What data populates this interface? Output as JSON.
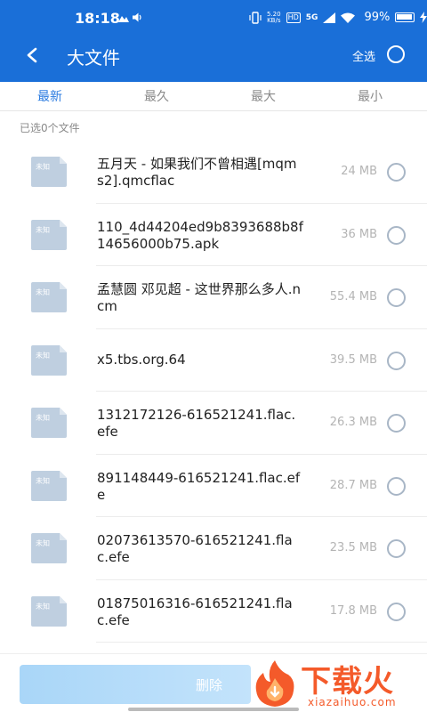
{
  "status_bar": {
    "time": "18:18",
    "speed_top": "5.20",
    "speed_unit": "KB/s",
    "hd_badge": "HD",
    "network": "5G",
    "battery": "99%"
  },
  "toolbar": {
    "title": "大文件",
    "select_all": "全选"
  },
  "tabs": [
    {
      "label": "最新",
      "active": true
    },
    {
      "label": "最久",
      "active": false
    },
    {
      "label": "最大",
      "active": false
    },
    {
      "label": "最小",
      "active": false
    }
  ],
  "selected_count": "已选0个文件",
  "file_icon_label": "未知",
  "files": [
    {
      "name": "五月天 - 如果我们不曾相遇[mqms2].qmcflac",
      "size": "24 MB"
    },
    {
      "name": "110_4d44204ed9b8393688b8f14656000b75.apk",
      "size": "36 MB"
    },
    {
      "name": "孟慧圆 邓见超 - 这世界那么多人.ncm",
      "size": "55.4 MB"
    },
    {
      "name": "x5.tbs.org.64",
      "size": "39.5 MB"
    },
    {
      "name": "1312172126-616521241.flac.efe",
      "size": "26.3 MB"
    },
    {
      "name": "891148449-616521241.flac.efe",
      "size": "28.7 MB"
    },
    {
      "name": "02073613570-616521241.flac.efe",
      "size": "23.5 MB"
    },
    {
      "name": "01875016316-616521241.flac.efe",
      "size": "17.8 MB"
    }
  ],
  "bottom": {
    "delete_label": "删除"
  },
  "watermark": {
    "title": "下载火",
    "url": "xiazaihuo.com"
  },
  "colors": {
    "accent": "#1a6fd8",
    "tab_active": "#2b7be0",
    "watermark": "#f45a2a"
  }
}
